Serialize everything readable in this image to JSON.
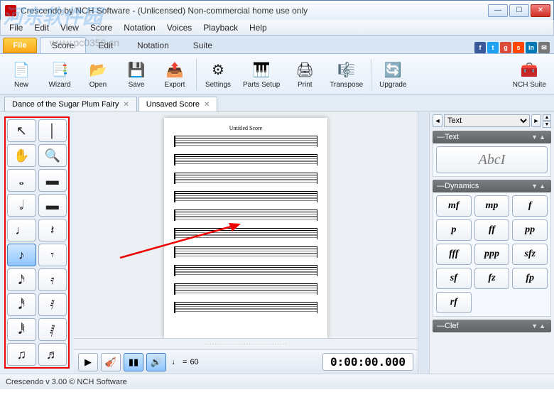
{
  "window": {
    "title": "Crescendo by NCH Software - (Unlicensed) Non-commercial home use only"
  },
  "menu": [
    "File",
    "Edit",
    "View",
    "Score",
    "Notation",
    "Voices",
    "Playback",
    "Help"
  ],
  "ribbon": {
    "file": "File",
    "tabs": [
      "Score",
      "Edit",
      "Notation",
      "Suite"
    ],
    "active": 0
  },
  "toolbar": [
    {
      "label": "New",
      "icon": "📄"
    },
    {
      "label": "Wizard",
      "icon": "📑"
    },
    {
      "label": "Open",
      "icon": "📂"
    },
    {
      "label": "Save",
      "icon": "💾"
    },
    {
      "label": "Export",
      "icon": "📤"
    },
    {
      "label": "Settings",
      "icon": "⚙"
    },
    {
      "label": "Parts Setup",
      "icon": "🎹"
    },
    {
      "label": "Print",
      "icon": "🖨"
    },
    {
      "label": "Transpose",
      "icon": "🎼"
    },
    {
      "label": "Upgrade",
      "icon": "🔄"
    },
    {
      "label": "NCH Suite",
      "icon": "🧰"
    }
  ],
  "doc_tabs": [
    {
      "label": "Dance of the Sugar Plum Fairy",
      "active": false
    },
    {
      "label": "Unsaved Score",
      "active": true
    }
  ],
  "page": {
    "title": "Untitled Score",
    "staves": 10
  },
  "palette": [
    {
      "g": "↖",
      "name": "selection-tool"
    },
    {
      "g": "│",
      "name": "barline-tool"
    },
    {
      "g": "✋",
      "name": "hand-tool"
    },
    {
      "g": "🔍",
      "name": "zoom-tool"
    },
    {
      "g": "𝅝",
      "name": "whole-note"
    },
    {
      "g": "▬",
      "name": "whole-rest"
    },
    {
      "g": "𝅗𝅥",
      "name": "half-note"
    },
    {
      "g": "▬",
      "name": "half-rest"
    },
    {
      "g": "♩",
      "name": "quarter-note"
    },
    {
      "g": "𝄽",
      "name": "quarter-rest"
    },
    {
      "g": "♪",
      "name": "eighth-note",
      "sel": true
    },
    {
      "g": "𝄾",
      "name": "eighth-rest"
    },
    {
      "g": "𝅘𝅥𝅯",
      "name": "sixteenth-note"
    },
    {
      "g": "𝄿",
      "name": "sixteenth-rest"
    },
    {
      "g": "𝅘𝅥𝅰",
      "name": "thirtysecond-note"
    },
    {
      "g": "𝅀",
      "name": "thirtysecond-rest"
    },
    {
      "g": "𝅘𝅥𝅱",
      "name": "sixtyfourth-note"
    },
    {
      "g": "𝅁",
      "name": "sixtyfourth-rest"
    },
    {
      "g": "♫",
      "name": "beam-eighth"
    },
    {
      "g": "♬",
      "name": "beam-sixteenth"
    }
  ],
  "playback": {
    "tempo_note": "♩",
    "tempo_eq": "=",
    "tempo_val": "60",
    "timecode": "0:00:00.000"
  },
  "right": {
    "selector": "Text",
    "sections": {
      "text": {
        "title": "Text",
        "button": "AbcI"
      },
      "dynamics": {
        "title": "Dynamics",
        "items": [
          "mf",
          "mp",
          "f",
          "p",
          "ff",
          "pp",
          "fff",
          "ppp",
          "sfz",
          "sf",
          "fz",
          "fp",
          "rf"
        ]
      },
      "clef": {
        "title": "Clef"
      }
    }
  },
  "status": "Crescendo v 3.00 © NCH Software",
  "watermark": {
    "a": "河东软件园",
    "b": "www.pc0359.cn"
  }
}
